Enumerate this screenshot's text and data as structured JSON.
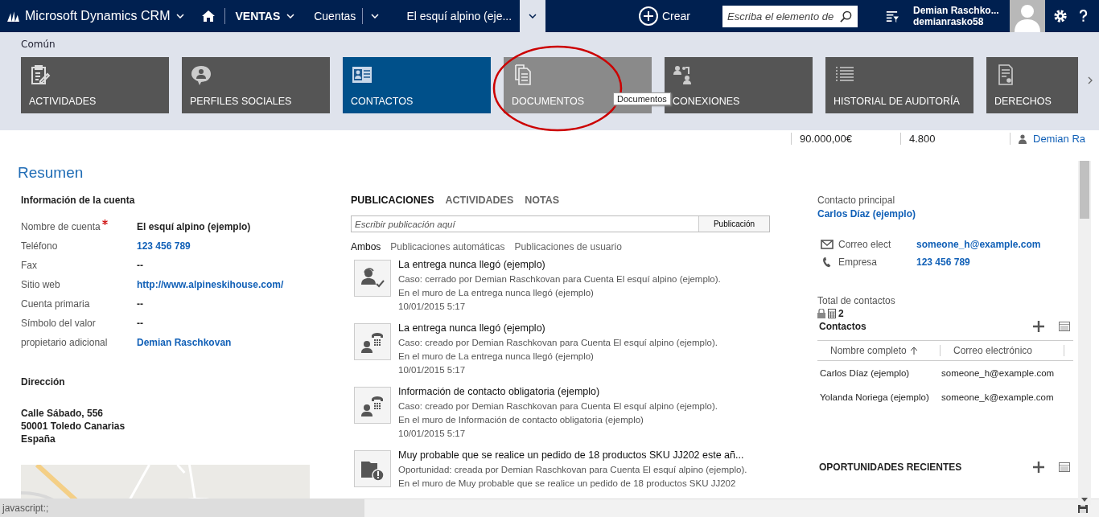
{
  "nav": {
    "app_title": "Microsoft Dynamics CRM",
    "area": "VENTAS",
    "entity": "Cuentas",
    "record": "El esquí alpino (eje...",
    "create": "Crear",
    "search": {
      "placeholder": "Escriba el elemento de"
    },
    "user_name": "Demian Raschko...",
    "user_org": "demianrasko58"
  },
  "ribbon": {
    "group": "Común",
    "tiles": [
      {
        "label": "ACTIVIDADES",
        "kind": "activities",
        "selected": false,
        "hovered": false
      },
      {
        "label": "PERFILES SOCIALES",
        "kind": "social",
        "selected": false,
        "hovered": false
      },
      {
        "label": "CONTACTOS",
        "kind": "contacts",
        "selected": true,
        "hovered": false
      },
      {
        "label": "DOCUMENTOS",
        "kind": "documents",
        "selected": false,
        "hovered": true
      },
      {
        "label": "CONEXIONES",
        "kind": "connections",
        "selected": false,
        "hovered": false
      },
      {
        "label": "HISTORIAL DE AUDITORÍA",
        "kind": "audit",
        "selected": false,
        "hovered": false
      },
      {
        "label": "DERECHOS",
        "kind": "rights",
        "selected": false,
        "hovered": false
      }
    ],
    "tooltip": "Documentos"
  },
  "header": {
    "fields": [
      "90.000,00€",
      "4.800"
    ],
    "owner": "Demian Ra"
  },
  "summary": {
    "title": "Resumen",
    "section": "Información de la cuenta",
    "fields": [
      {
        "label": "Nombre de cuenta",
        "value": "El esquí alpino (ejemplo)",
        "required": true,
        "kind": "text"
      },
      {
        "label": "Teléfono",
        "value": "123 456 789",
        "required": false,
        "kind": "link"
      },
      {
        "label": "Fax",
        "value": "--",
        "required": false,
        "kind": "text"
      },
      {
        "label": "Sitio web",
        "value": "http://www.alpineskihouse.com/",
        "required": false,
        "kind": "link"
      },
      {
        "label": "Cuenta primaria",
        "value": "--",
        "required": false,
        "kind": "text"
      },
      {
        "label": "Símbolo del valor",
        "value": "--",
        "required": false,
        "kind": "text"
      },
      {
        "label": "propietario adicional",
        "value": "Demian Raschkovan",
        "required": false,
        "kind": "link"
      }
    ],
    "address_title": "Dirección",
    "address": [
      "Calle Sábado, 556",
      "50001 Toledo Canarias",
      "España"
    ]
  },
  "posts": {
    "tabs": [
      {
        "label": "PUBLICACIONES",
        "selected": true
      },
      {
        "label": "ACTIVIDADES",
        "selected": false
      },
      {
        "label": "NOTAS",
        "selected": false
      }
    ],
    "input": {
      "placeholder": "Escribir publicación aquí"
    },
    "post_button": "Publicación",
    "filters": [
      {
        "label": "Ambos",
        "selected": true
      },
      {
        "label": "Publicaciones automáticas",
        "selected": false
      },
      {
        "label": "Publicaciones de usuario",
        "selected": false
      }
    ],
    "items": [
      {
        "kind": "case-closed",
        "title": "La entrega nunca llegó (ejemplo)",
        "line": "Caso: cerrado por Demian Raschkovan para Cuenta El esquí alpino (ejemplo).",
        "wall": "En el muro de La entrega nunca llegó (ejemplo)",
        "time": "10/01/2015 5:17"
      },
      {
        "kind": "phone",
        "title": "La entrega nunca llegó (ejemplo)",
        "line": "Caso: creado por Demian Raschkovan para Cuenta El esquí alpino (ejemplo).",
        "wall": "En el muro de La entrega nunca llegó (ejemplo)",
        "time": "10/01/2015 5:17"
      },
      {
        "kind": "phone",
        "title": "Información de contacto obligatoria (ejemplo)",
        "line": "Caso: creado por Demian Raschkovan para Cuenta El esquí alpino (ejemplo).",
        "wall": "En el muro de Información de contacto obligatoria (ejemplo)",
        "time": "10/01/2015 5:17"
      },
      {
        "kind": "opportunity",
        "title": "Muy probable que se realice un pedido de 18 productos SKU JJ202 este añ...",
        "line": "Oportunidad: creada por Demian Raschkovan para Cuenta El esquí alpino (ejemplo).",
        "wall": "En el muro de Muy probable que se realice un pedido de 18 productos SKU JJ202"
      }
    ]
  },
  "contact": {
    "label": "Contacto principal",
    "name": "Carlos Díaz (ejemplo)",
    "rows": [
      {
        "kind": "email",
        "label": "Correo elect",
        "value": "someone_h@example.com"
      },
      {
        "kind": "phone",
        "label": "Empresa",
        "value": "123 456 789"
      }
    ],
    "total_label": "Total de contactos",
    "total": "2"
  },
  "contacts": {
    "title": "Contactos",
    "columns": [
      "Nombre completo",
      "Correo electrónico"
    ],
    "rows": [
      [
        "Carlos Díaz (ejemplo)",
        "someone_h@example.com"
      ],
      [
        "Yolanda Noriega (ejemplo)",
        "someone_k@example.com"
      ]
    ]
  },
  "opportunities": {
    "title": "OPORTUNIDADES RECIENTES"
  },
  "status_bar": "javascript:;"
}
